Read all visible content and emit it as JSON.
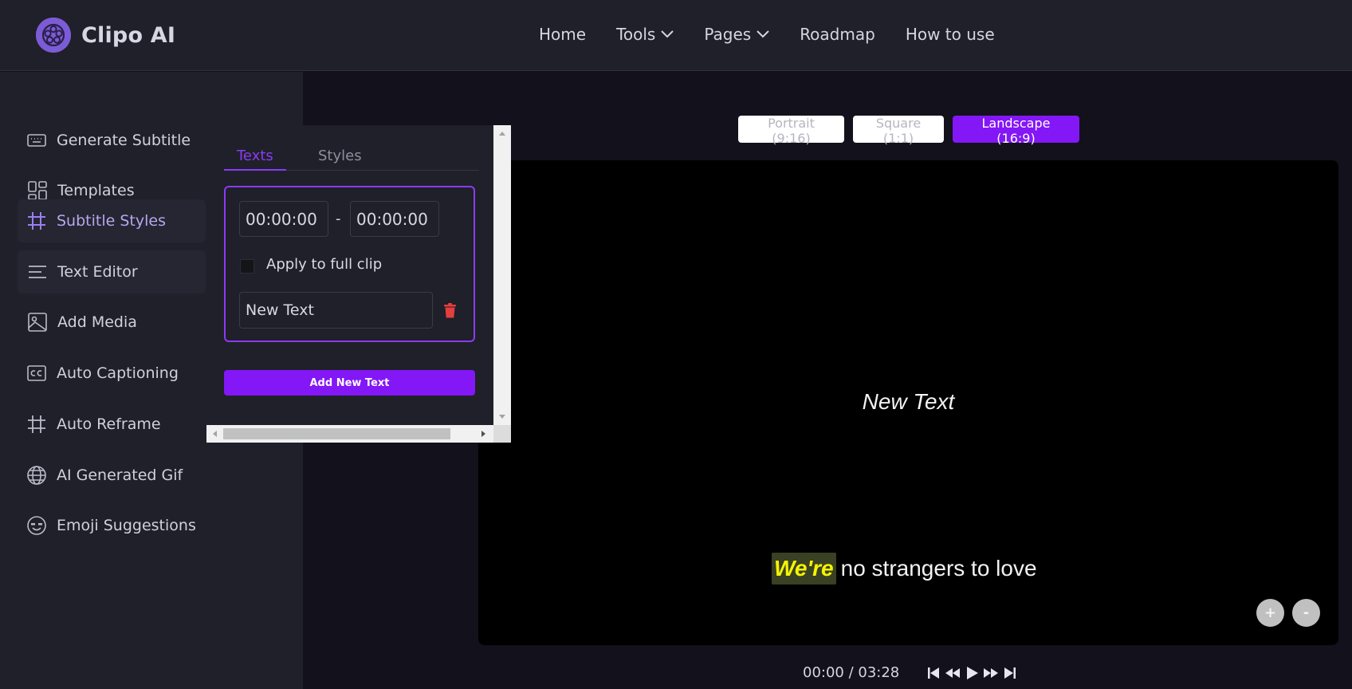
{
  "brand": {
    "name": "Clipo AI",
    "accent": "#8317f6",
    "logo_color": "#7c5cd6"
  },
  "nav": {
    "items": [
      {
        "label": "Home",
        "has_dropdown": false
      },
      {
        "label": "Tools",
        "has_dropdown": true
      },
      {
        "label": "Pages",
        "has_dropdown": true
      },
      {
        "label": "Roadmap",
        "has_dropdown": false
      },
      {
        "label": "How to use",
        "has_dropdown": false
      }
    ]
  },
  "sidebar": {
    "items": [
      {
        "label": "Generate Subtitle",
        "icon": "keyboard-icon"
      },
      {
        "label": "Templates",
        "icon": "grid-icon"
      },
      {
        "label": "Subtitle Styles",
        "icon": "hash-icon",
        "active": true
      },
      {
        "label": "Text Editor",
        "icon": "lines-icon"
      },
      {
        "label": "Add Media",
        "icon": "image-icon"
      },
      {
        "label": "Auto Captioning",
        "icon": "cc-icon"
      },
      {
        "label": "Auto Reframe",
        "icon": "hash-icon"
      },
      {
        "label": "AI Generated Gif",
        "icon": "globe-icon"
      },
      {
        "label": "Emoji Suggestions",
        "icon": "emoji-icon"
      }
    ]
  },
  "panel": {
    "tabs": [
      {
        "label": "Texts",
        "active": true
      },
      {
        "label": "Styles",
        "active": false
      }
    ],
    "text_entry": {
      "start_time": "00:00:00",
      "separator": "-",
      "end_time": "00:00:00",
      "apply_full_clip_label": "Apply to full clip",
      "apply_full_clip_checked": false,
      "text_value": "New Text"
    },
    "add_button_label": "Add New Text"
  },
  "aspect_ratios": [
    {
      "label": "Portrait (9:16)",
      "selected": false
    },
    {
      "label": "Square (1:1)",
      "selected": false
    },
    {
      "label": "Landscape (16:9)",
      "selected": true
    }
  ],
  "canvas": {
    "overlay_text": "New Text",
    "subtitle_highlight": "We're",
    "subtitle_rest": "no strangers to love",
    "highlight_color": "#f4f400",
    "zoom_in_label": "+",
    "zoom_out_label": "-"
  },
  "playback": {
    "current": "00:00",
    "separator": " / ",
    "duration": "03:28",
    "time_display": "00:00 / 03:28"
  }
}
